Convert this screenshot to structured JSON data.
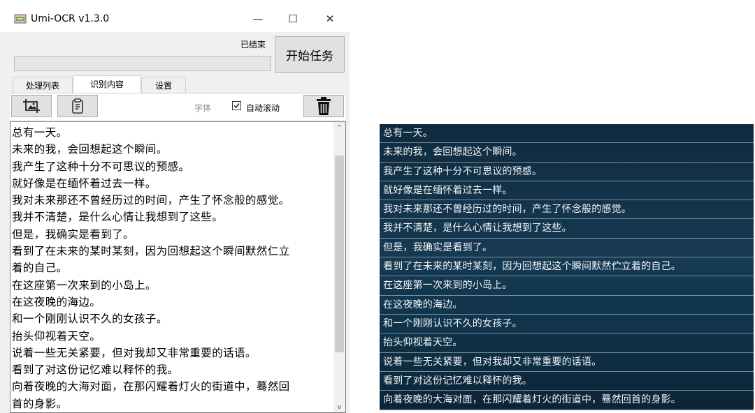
{
  "window": {
    "title": "Umi-OCR v1.3.0",
    "controls": {
      "minimize": "—",
      "maximize": "☐",
      "close": "✕"
    }
  },
  "status": {
    "label": "已结束"
  },
  "start_button": {
    "label": "开始任务"
  },
  "tabs": [
    {
      "label": "处理列表"
    },
    {
      "label": "识别内容"
    },
    {
      "label": "设置"
    }
  ],
  "toolbar": {
    "font_label": "字体",
    "auto_scroll_label": "自动滚动",
    "auto_scroll_checked": true
  },
  "result_lines": [
    "总有一天。",
    "未来的我，会回想起这个瞬间。",
    "我产生了这种十分不可思议的预感。",
    "就好像是在缅怀着过去一样。",
    "我对未来那还不曾经历过的时间，产生了怀念般的感觉。",
    "我并不清楚，是什么心情让我想到了这些。",
    "但是，我确实是看到了。",
    "看到了在未来的某时某刻，因为回想起这个瞬间默然仁立",
    "着的自己。",
    "在这座第一次来到的小岛上。",
    "在这夜晚的海边。",
    "和一个刚刚认识不久的女孩子。",
    "抬头仰视着天空。",
    "说着一些无关紧要，但对我却又非常重要的话语。",
    "看到了对这份记忆难以释怀的我。",
    "向着夜晚的大海对面，在那闪耀着灯火的街道中，蓦然回",
    "首的身影。"
  ],
  "subtitle_lines": [
    "总有一天。",
    "未来的我，会回想起这个瞬间。",
    "我产生了这种十分不可思议的预感。",
    "就好像是在缅怀着过去一样。",
    "我对未来那还不曾经历过的时间，产生了怀念般的感觉。",
    "我并不清楚，是什么心情让我想到了这些。",
    "但是，我确实是看到了。",
    "看到了在未来的某时某刻，因为回想起这个瞬间默然伫立着的自己。",
    "在这座第一次来到的小岛上。",
    "在这夜晚的海边。",
    "和一个刚刚认识不久的女孩子。",
    "抬头仰视着天空。",
    "说着一些无关紧要，但对我却又非常重要的话语。",
    "看到了对这份记忆难以释怀的我。",
    "向着夜晚的大海对面，在那闪耀着灯火的街道中，蓦然回首的身影。"
  ]
}
